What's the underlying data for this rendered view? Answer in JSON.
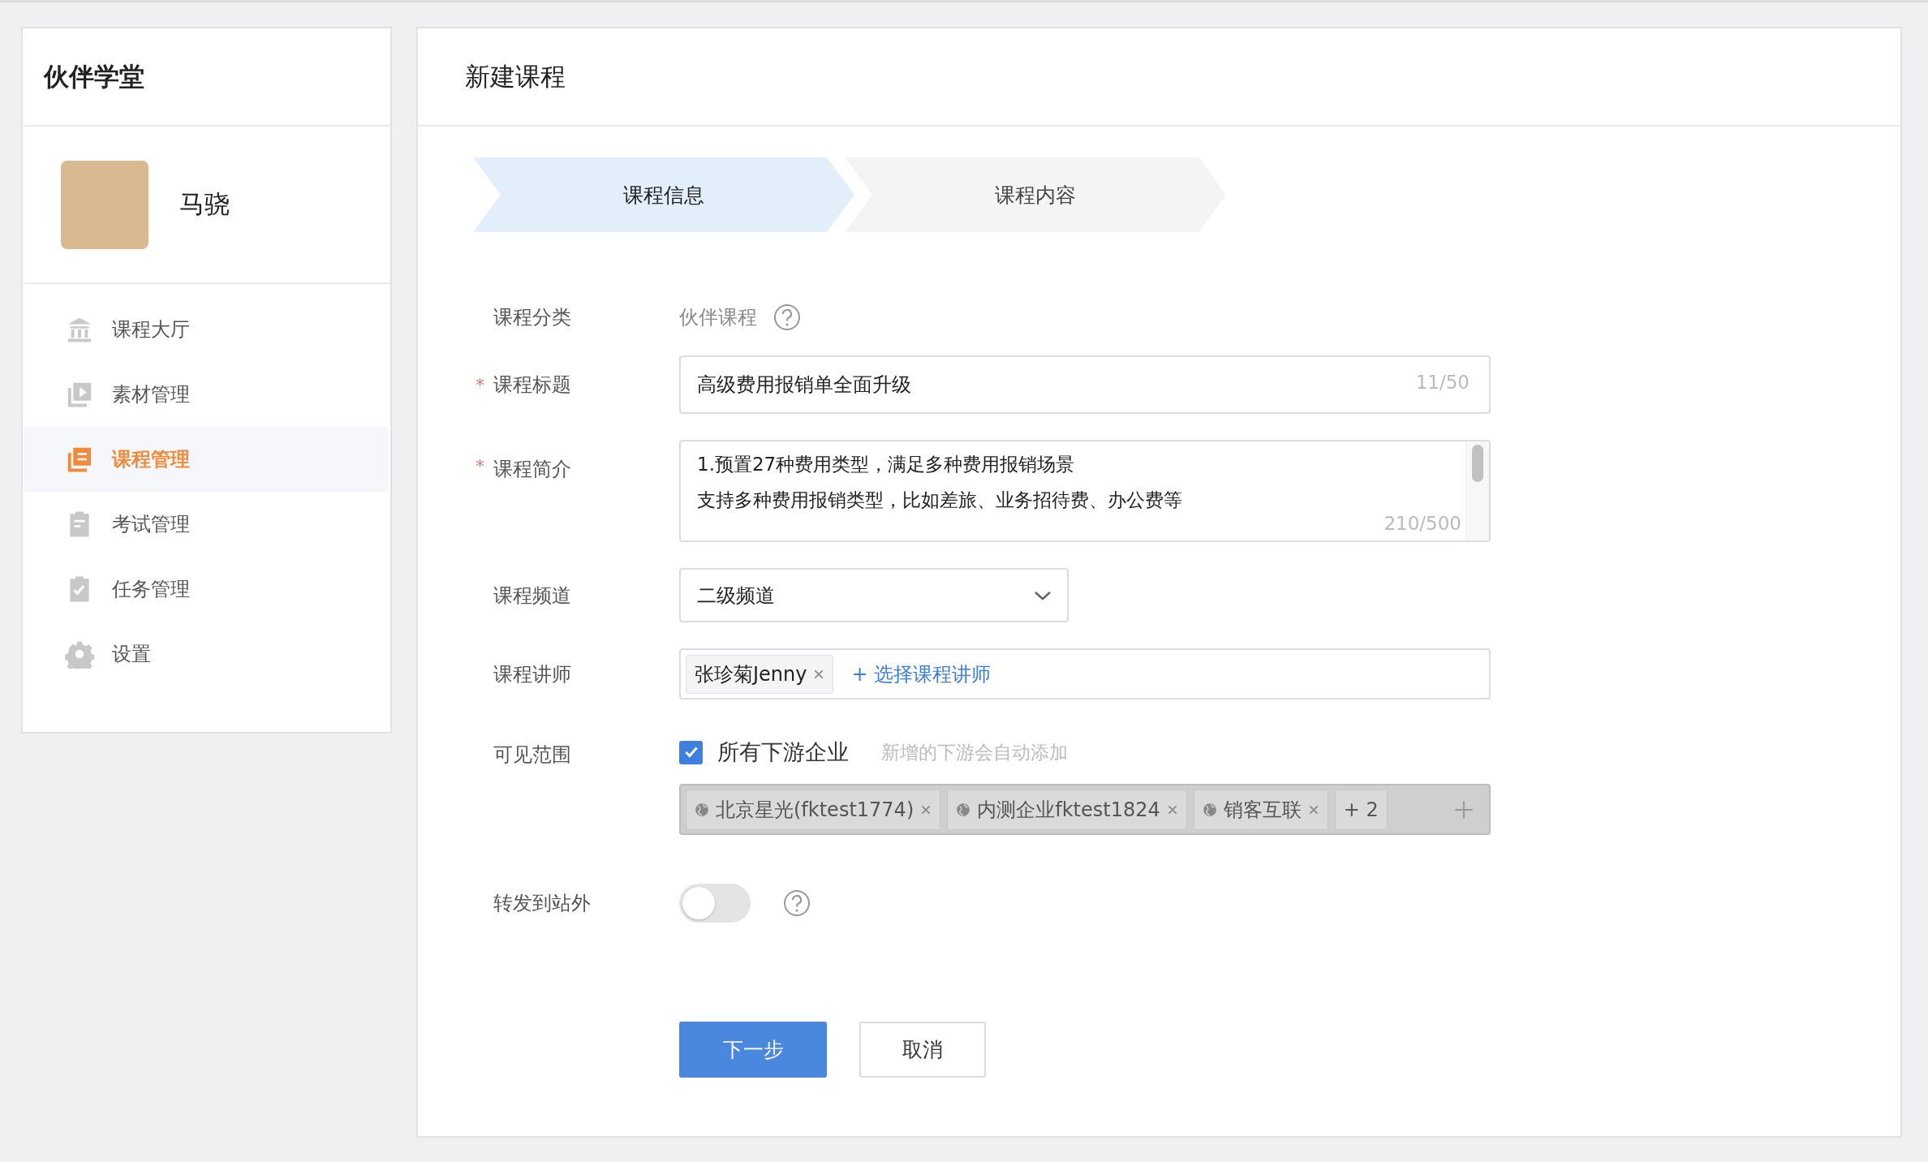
{
  "sidebar": {
    "title": "伙伴学堂",
    "user": {
      "name": "马骁"
    },
    "items": [
      {
        "label": "课程大厅",
        "selected": false
      },
      {
        "label": "素材管理",
        "selected": false
      },
      {
        "label": "课程管理",
        "selected": true
      },
      {
        "label": "考试管理",
        "selected": false
      },
      {
        "label": "任务管理",
        "selected": false
      },
      {
        "label": "设置",
        "selected": false
      }
    ]
  },
  "page": {
    "title": "新建课程"
  },
  "steps": [
    {
      "label": "课程信息",
      "selected": true
    },
    {
      "label": "课程内容",
      "selected": false
    }
  ],
  "form": {
    "category": {
      "label": "课程分类",
      "value": "伙伴课程"
    },
    "title": {
      "label": "课程标题",
      "required_mark": "*",
      "value": "高级费用报销单全面升级",
      "counter": "11/50"
    },
    "intro": {
      "label": "课程简介",
      "required_mark": "*",
      "lines": [
        "1.预置27种费用类型，满足多种费用报销场景",
        "支持多种费用报销类型，比如差旅、业务招待费、办公费等"
      ],
      "counter": "210/500"
    },
    "channel": {
      "label": "课程频道",
      "value": "二级频道"
    },
    "teacher": {
      "label": "课程讲师",
      "tags": [
        "张珍菊Jenny"
      ],
      "add_link": "+ 选择课程讲师"
    },
    "scope": {
      "label": "可见范围",
      "checked": true,
      "option": "所有下游企业",
      "hint": "新增的下游会自动添加",
      "disabled": true,
      "tags": [
        "北京星光(fktest1774)",
        "内测企业fktest1824",
        "销客互联"
      ],
      "more": "+ 2"
    },
    "share": {
      "label": "转发到站外",
      "on": false
    }
  },
  "buttons": [
    {
      "label": "下一步",
      "kind": "primary"
    },
    {
      "label": "取消",
      "kind": "default"
    }
  ]
}
